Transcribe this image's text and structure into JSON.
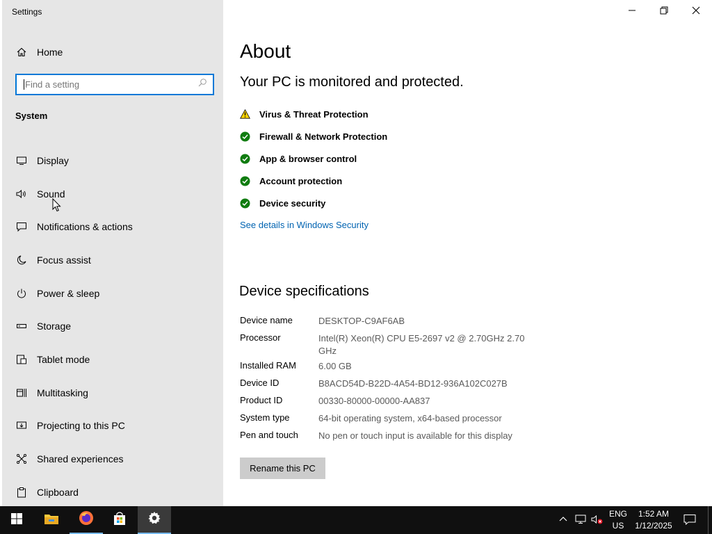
{
  "window": {
    "title": "Settings",
    "controls": {
      "minimize": "minimize-icon",
      "maximize": "restore-icon",
      "close": "close-icon"
    }
  },
  "sidebar": {
    "home_label": "Home",
    "search_placeholder": "Find a setting",
    "section_label": "System",
    "items": [
      {
        "label": "Display",
        "icon": "display-icon"
      },
      {
        "label": "Sound",
        "icon": "sound-icon"
      },
      {
        "label": "Notifications & actions",
        "icon": "notifications-icon"
      },
      {
        "label": "Focus assist",
        "icon": "moon-icon"
      },
      {
        "label": "Power & sleep",
        "icon": "power-icon"
      },
      {
        "label": "Storage",
        "icon": "storage-icon"
      },
      {
        "label": "Tablet mode",
        "icon": "tablet-icon"
      },
      {
        "label": "Multitasking",
        "icon": "multitasking-icon"
      },
      {
        "label": "Projecting to this PC",
        "icon": "projecting-icon"
      },
      {
        "label": "Shared experiences",
        "icon": "shared-icon"
      },
      {
        "label": "Clipboard",
        "icon": "clipboard-icon"
      }
    ]
  },
  "main": {
    "title": "About",
    "protection_heading": "Your PC is monitored and protected.",
    "protections": [
      {
        "label": "Virus & Threat Protection",
        "status": "warning"
      },
      {
        "label": "Firewall & Network Protection",
        "status": "ok"
      },
      {
        "label": "App & browser control",
        "status": "ok"
      },
      {
        "label": "Account protection",
        "status": "ok"
      },
      {
        "label": "Device security",
        "status": "ok"
      }
    ],
    "security_link": "See details in Windows Security",
    "specs_heading": "Device specifications",
    "specs": [
      {
        "key": "Device name",
        "value": "DESKTOP-C9AF6AB"
      },
      {
        "key": "Processor",
        "value": "Intel(R) Xeon(R) CPU E5-2697 v2 @ 2.70GHz   2.70 GHz"
      },
      {
        "key": "Installed RAM",
        "value": "6.00 GB"
      },
      {
        "key": "Device ID",
        "value": "B8ACD54D-B22D-4A54-BD12-936A102C027B"
      },
      {
        "key": "Product ID",
        "value": "00330-80000-00000-AA837"
      },
      {
        "key": "System type",
        "value": "64-bit operating system, x64-based processor"
      },
      {
        "key": "Pen and touch",
        "value": "No pen or touch input is available for this display"
      }
    ],
    "rename_button": "Rename this PC"
  },
  "taskbar": {
    "apps": [
      {
        "name": "start",
        "icon": "windows-logo-icon"
      },
      {
        "name": "file-explorer",
        "icon": "folder-icon"
      },
      {
        "name": "firefox",
        "icon": "firefox-icon"
      },
      {
        "name": "microsoft-store",
        "icon": "store-icon"
      },
      {
        "name": "settings",
        "icon": "gear-icon"
      }
    ],
    "language_top": "ENG",
    "language_bottom": "US",
    "time": "1:52 AM",
    "date": "1/12/2025"
  },
  "colors": {
    "accent": "#0078d7",
    "link": "#0063b1",
    "ok_green": "#107c10",
    "warning_yellow": "#ffd400",
    "sidebar_bg": "#e6e6e6",
    "taskbar_bg": "#101010"
  }
}
